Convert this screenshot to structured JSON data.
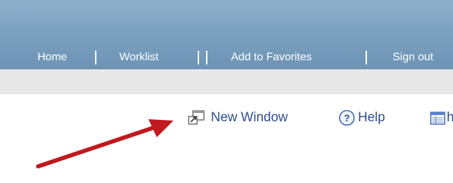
{
  "nav": {
    "home": "Home",
    "worklist": "Worklist",
    "add_to_favorites": "Add to Favorites",
    "sign_out": "Sign out"
  },
  "toolbar": {
    "new_window": "New Window",
    "help": "Help",
    "http": "htt"
  },
  "colors": {
    "header": "#7ea3c2",
    "link": "#2f4f8b",
    "arrow": "#c0191e"
  }
}
